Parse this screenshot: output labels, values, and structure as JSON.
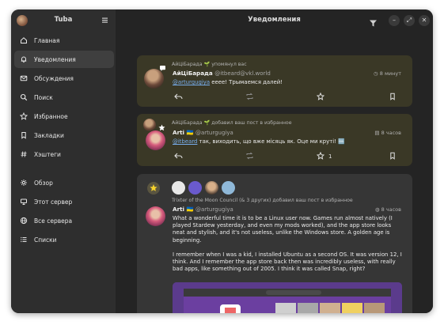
{
  "app": {
    "title": "Tuba"
  },
  "header": {
    "title": "Уведомления",
    "filter_icon": "filter-icon",
    "minimize": "–",
    "maximize": "⤢",
    "close": "✕"
  },
  "sidebar": {
    "items": [
      {
        "label": "Главная",
        "icon": "home-icon"
      },
      {
        "label": "Уведомления",
        "icon": "bell-icon",
        "active": true
      },
      {
        "label": "Обсуждения",
        "icon": "mail-icon"
      },
      {
        "label": "Поиск",
        "icon": "search-icon"
      },
      {
        "label": "Избранное",
        "icon": "star-icon"
      },
      {
        "label": "Закладки",
        "icon": "bookmark-icon"
      },
      {
        "label": "Хэштеги",
        "icon": "hashtag-icon"
      },
      {
        "label": "Обзор",
        "icon": "explore-icon"
      },
      {
        "label": "Этот сервер",
        "icon": "server-icon"
      },
      {
        "label": "Все сервера",
        "icon": "globe-icon"
      },
      {
        "label": "Списки",
        "icon": "list-icon"
      }
    ]
  },
  "notifications": [
    {
      "meta": "АйЦіБарада 🌱 упомянул вас",
      "author": "АйЦіБарада",
      "handle": "@itbeard@vkl.world",
      "time": "8 минут",
      "mention": "@arturgugiya",
      "text": " ееее! Трымаемся далей!"
    },
    {
      "meta": "АйЦіБарада 🌱 добавил ваш пост в избранное",
      "author": "Arti 🇺🇦",
      "handle": "@arturgugiya",
      "time": "8 часов",
      "mention": "@itbeard",
      "text": " так, виходить, що вже місяць як. Оце ми круті! 🆒",
      "favorites": "1"
    },
    {
      "meta": "Trixter of the Moon Council (& 3 других) добавил ваш пост в избранное",
      "author": "Arti 🇺🇦",
      "handle": "@arturgugiya",
      "time": "8 часов",
      "text_p1": "What a wonderful time it is to be a Linux user now. Games run almost natively (I played Stardew yesterday, and even my mods worked), and the app store looks neat and stylish, and it's not useless, unlike the Windows store. A golden age is beginning.",
      "text_p2": "I remember when I was a kid, I installed Ubuntu as a second OS. It was version 12, I think. And I remember the app store back then was incredibly useless, with really bad apps, like something out of 2005. I think it was called Snap, right?"
    }
  ],
  "colors": {
    "window_bg": "#242424",
    "sidebar_bg": "#2e2e2e",
    "highlight_card": "#3a3826",
    "card": "#363636",
    "link": "#78aeed",
    "accent_star": "#f6d32d"
  }
}
